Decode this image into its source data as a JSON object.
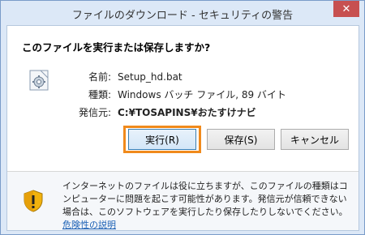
{
  "window": {
    "title": "ファイルのダウンロード - セキュリティの警告",
    "close_glyph": "✕"
  },
  "dialog": {
    "question": "このファイルを実行または保存しますか?",
    "file_icon": "setup-gear-file-icon",
    "name_label": "名前:",
    "name_value": "Setup_hd.bat",
    "type_label": "種類:",
    "type_value": "Windows バッチ ファイル, 89 バイト",
    "from_label": "発信元:",
    "from_value": "C:¥TOSAPINS¥おたすけナビ"
  },
  "buttons": {
    "run_label": "実行(R)",
    "save_label": "保存(S)",
    "cancel_label": "キャンセル"
  },
  "warning": {
    "icon": "shield-warning-icon",
    "text": "インターネットのファイルは役に立ちますが、このファイルの種類はコンピューターに問題を起こす可能性があります。発信元が信頼できない場合は、このソフトウェアを実行したり保存したりしないでください。",
    "link_label": "危険性の説明"
  },
  "colors": {
    "title_bg": "#dce8f7",
    "close_bg": "#c75050",
    "highlight": "#f08a1c",
    "link": "#1a5fb4"
  }
}
